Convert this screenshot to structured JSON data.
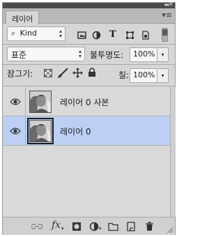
{
  "panel": {
    "tab_label": "레이어",
    "collapse_glyph": "◂◂",
    "close_glyph": "✕",
    "menu_glyph": "▾≡"
  },
  "filter": {
    "kind_label": "Kind",
    "search_glyph": "⌕"
  },
  "blend": {
    "mode_value": "표준",
    "opacity_label": "불투명도:",
    "opacity_value": "100%"
  },
  "lock": {
    "label": "잠그기:",
    "fill_label": "칠:",
    "fill_value": "100%"
  },
  "layers": [
    {
      "name": "레이어 0 사본",
      "visible": true,
      "selected": false
    },
    {
      "name": "레이어 0",
      "visible": true,
      "selected": true
    }
  ],
  "bottom": {
    "fx_label": "fx"
  },
  "colors": {
    "selected_row": "#bcd0f5",
    "panel_bg": "#d6d6d6",
    "header_bg": "#4a4a4a"
  }
}
